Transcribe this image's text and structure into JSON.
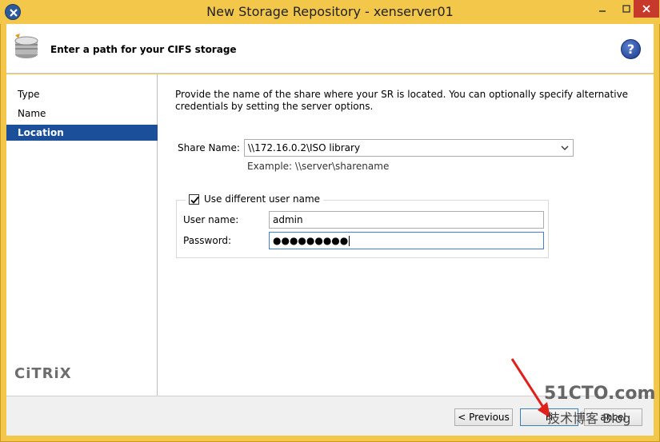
{
  "window": {
    "title": "New Storage Repository - xenserver01"
  },
  "header": {
    "title": "Enter a path for your CIFS storage",
    "help": "?"
  },
  "sidebar": {
    "items": [
      {
        "label": "Type",
        "active": false
      },
      {
        "label": "Name",
        "active": false
      },
      {
        "label": "Location",
        "active": true
      }
    ],
    "logo": "CiTRiX"
  },
  "main": {
    "description": "Provide the name of the share where your SR is located. You can optionally specify alternative credentials by setting the server options.",
    "share_label": "Share Name:",
    "share_value": "\\\\172.16.0.2\\ISO library",
    "example": "Example: \\\\server\\sharename",
    "use_different_user_label": "Use different user name",
    "use_different_user_checked": true,
    "username_label": "User name:",
    "username_value": "admin",
    "password_label": "Password:",
    "password_value": "●●●●●●●●●"
  },
  "footer": {
    "previous": "< Previous",
    "finish": "Fi",
    "cancel": "ancel"
  },
  "watermark": {
    "line1": "51CTO.com",
    "line2": "技术博客 Blog"
  },
  "colors": {
    "frame": "#f2c74a",
    "nav_active": "#1b4f99",
    "close_button": "#c7392b"
  }
}
